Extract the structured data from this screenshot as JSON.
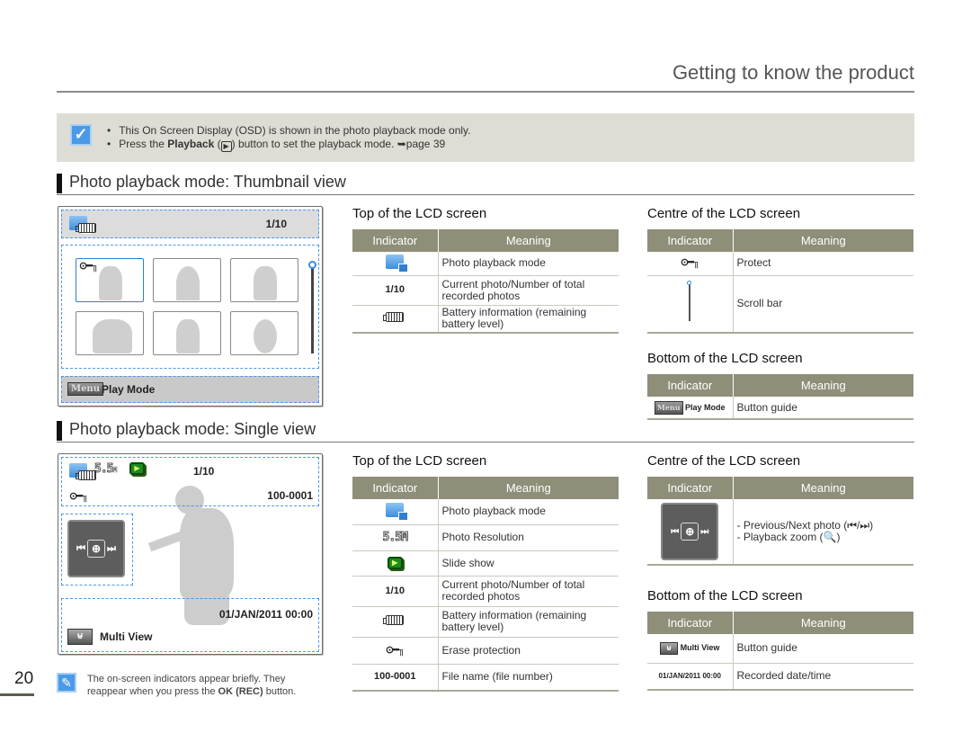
{
  "header": {
    "title": "Getting to know the product"
  },
  "note": {
    "items": [
      {
        "text": "This On Screen Display (OSD) is shown in the photo playback mode only."
      },
      {
        "pre": "Press the ",
        "bold": "Playback",
        "mid": " (",
        "icon": "▶",
        "post": ") button to set the playback mode. ➥page 39"
      }
    ]
  },
  "sections": {
    "thumbnail": {
      "title": "Photo playback mode: Thumbnail view",
      "lcd": {
        "counter": "1/10",
        "button_label": "Menu",
        "button_text": "Play Mode",
        "key_glyph": "⊙━╖"
      },
      "top_table": {
        "title": "Top of the LCD screen",
        "headers": [
          "Indicator",
          "Meaning"
        ],
        "rows": [
          {
            "indicator_icon": "photo-playback-icon",
            "indicator": "",
            "meaning": "Photo playback mode"
          },
          {
            "indicator_icon": "",
            "indicator": "1/10",
            "meaning": "Current photo/Number of total recorded photos"
          },
          {
            "indicator_icon": "battery-icon",
            "indicator": "",
            "meaning": "Battery information (remaining battery level)"
          }
        ]
      },
      "centre_table": {
        "title": "Centre of the LCD screen",
        "headers": [
          "Indicator",
          "Meaning"
        ],
        "rows": [
          {
            "indicator_icon": "protect-key-icon",
            "meaning": "Protect"
          },
          {
            "indicator_icon": "scroll-bar-icon",
            "meaning": "Scroll bar"
          }
        ]
      },
      "bottom_table": {
        "title": "Bottom of the LCD screen",
        "headers": [
          "Indicator",
          "Meaning"
        ],
        "rows": [
          {
            "indicator_icon": "menu-button-icon",
            "indicator": "Play Mode",
            "meaning": "Button guide"
          }
        ]
      }
    },
    "single": {
      "title": "Photo playback mode: Single view",
      "lcd": {
        "resolution": "5.5",
        "resolution_unit": "M",
        "counter": "1/10",
        "file_number": "100-0001",
        "datetime": "01/JAN/2011 00:00",
        "button_text": "Multi View"
      },
      "top_table": {
        "title": "Top of the LCD screen",
        "headers": [
          "Indicator",
          "Meaning"
        ],
        "rows": [
          {
            "indicator_icon": "photo-playback-icon",
            "indicator": "",
            "meaning": "Photo playback mode"
          },
          {
            "indicator_icon": "resolution-icon",
            "indicator": "5.5M",
            "meaning": "Photo Resolution"
          },
          {
            "indicator_icon": "slide-show-icon",
            "indicator": "",
            "meaning": "Slide show"
          },
          {
            "indicator_icon": "",
            "indicator": "1/10",
            "meaning": "Current photo/Number of total recorded photos"
          },
          {
            "indicator_icon": "battery-icon",
            "indicator": "",
            "meaning": "Battery information (remaining battery level)"
          },
          {
            "indicator_icon": "protect-key-icon",
            "indicator": "",
            "meaning": "Erase protection"
          },
          {
            "indicator_icon": "",
            "indicator": "100-0001",
            "meaning": "File name (file number)"
          }
        ]
      },
      "centre_table": {
        "title": "Centre of the LCD screen",
        "headers": [
          "Indicator",
          "Meaning"
        ],
        "rows": [
          {
            "indicator_icon": "nav-zoom-icon",
            "meaning_lines": [
              "- Previous/Next photo (⏮/⏭)",
              "- Playback zoom (🔍)"
            ]
          }
        ]
      },
      "bottom_table": {
        "title": "Bottom of the LCD screen",
        "headers": [
          "Indicator",
          "Meaning"
        ],
        "rows": [
          {
            "indicator_icon": "multi-view-button-icon",
            "indicator": "Multi View",
            "meaning": "Button guide"
          },
          {
            "indicator_icon": "",
            "indicator": "01/JAN/2011 00:00",
            "meaning": "Recorded date/time"
          }
        ]
      }
    }
  },
  "footer": {
    "page_number": "20",
    "tip_pre": "The on-screen indicators appear briefly. They reappear when you press the ",
    "tip_bold": "OK (REC)",
    "tip_post": " button."
  }
}
